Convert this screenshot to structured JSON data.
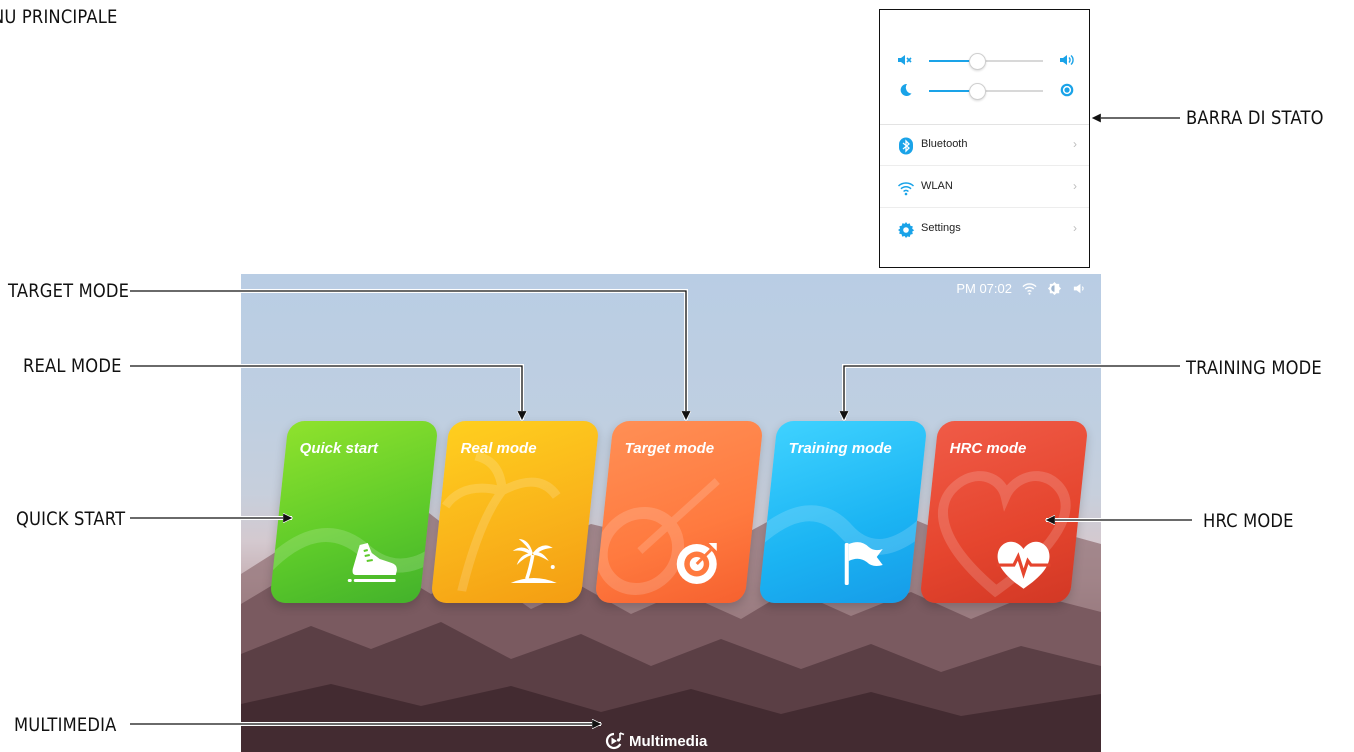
{
  "page_title": "NU PRINCIPALE",
  "callouts": {
    "target_mode": "TARGET MODE",
    "real_mode": "REAL MODE",
    "quick_start": "QUICK START",
    "multimedia": "MULTIMEDIA",
    "barra_di_stato": "BARRA DI STATO",
    "training_mode": "TRAINING MODE",
    "hrc_mode": "HRC MODE"
  },
  "status_panel": {
    "volume_level": 0.42,
    "brightness_level": 0.42,
    "menu": [
      {
        "label": "Bluetooth",
        "icon": "bluetooth-icon"
      },
      {
        "label": "WLAN",
        "icon": "wifi-icon"
      },
      {
        "label": "Settings",
        "icon": "gear-icon"
      }
    ],
    "chevron": "›"
  },
  "screen": {
    "time": "PM 07:02",
    "tray_icons": [
      "wifi-icon",
      "brightness-icon",
      "volume-icon"
    ],
    "cards": [
      {
        "id": "quick",
        "title": "Quick start",
        "icon": "shoe-icon"
      },
      {
        "id": "real",
        "title": "Real mode",
        "icon": "palm-island-icon"
      },
      {
        "id": "target",
        "title": "Target mode",
        "icon": "target-icon"
      },
      {
        "id": "training",
        "title": "Training mode",
        "icon": "flag-icon"
      },
      {
        "id": "hrc",
        "title": "HRC mode",
        "icon": "heartbeat-icon"
      }
    ],
    "multimedia_label": "Multimedia"
  },
  "colors": {
    "accent": "#1aa3e8",
    "quick": "#5dca2a",
    "real": "#f9b21a",
    "target": "#ff7a3f",
    "training": "#1bb4f3",
    "hrc": "#e5452e"
  }
}
